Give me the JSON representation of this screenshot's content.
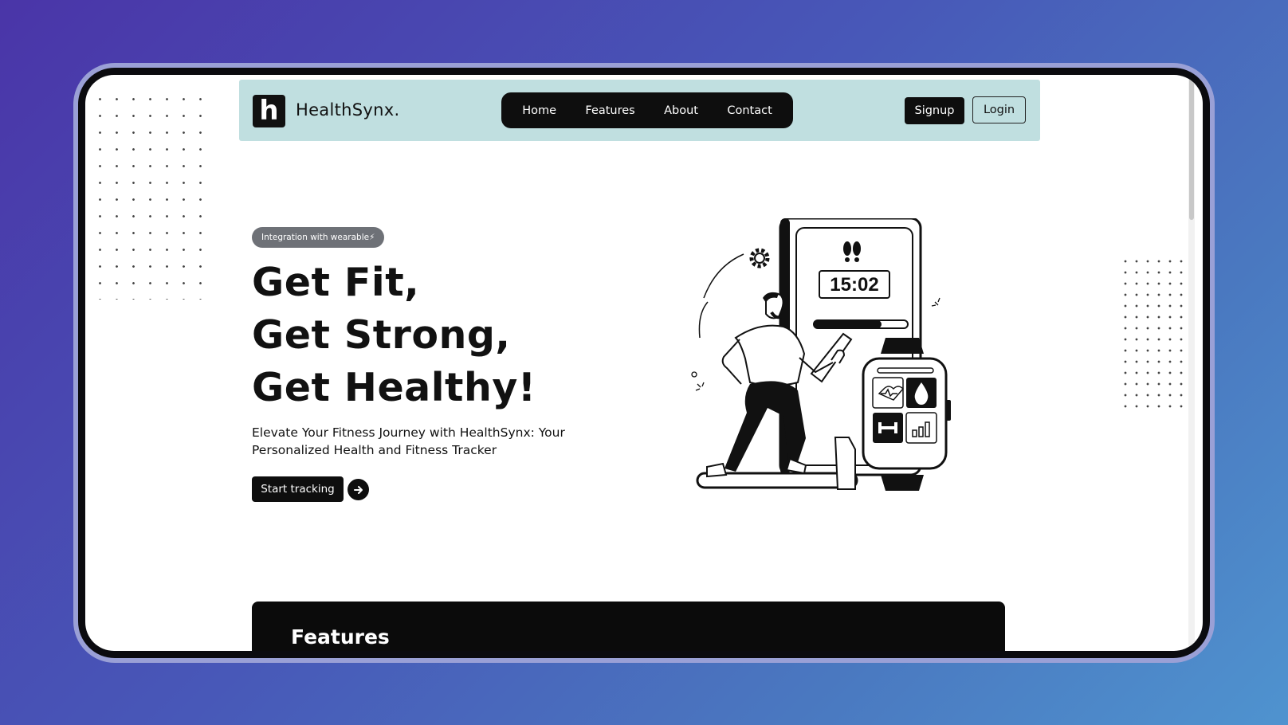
{
  "brand": {
    "name": "HealthSynx.",
    "logo_letter": "h"
  },
  "nav": {
    "links": [
      "Home",
      "Features",
      "About",
      "Contact"
    ],
    "signup_label": "Signup",
    "login_label": "Login"
  },
  "hero": {
    "badge": "Integration with wearable⚡",
    "title_lines": [
      "Get Fit,",
      "Get Strong,",
      "Get Healthy!"
    ],
    "subtitle": "Elevate Your Fitness Journey with HealthSynx: Your Personalized Health and Fitness Tracker",
    "cta_label": "Start tracking"
  },
  "illustration": {
    "timer": "15:02",
    "progress": 0.72,
    "watch_tiles": [
      "heart-rate-icon",
      "water-drop-icon",
      "dumbbell-icon",
      "bar-chart-icon"
    ]
  },
  "features": {
    "title": "Features"
  },
  "colors": {
    "navbar_bg": "#c0dfe0",
    "dark": "#0e0e0e",
    "badge_bg": "#6e7177",
    "background_gradient_start": "#4a35a8",
    "background_gradient_end": "#4f93cf"
  }
}
